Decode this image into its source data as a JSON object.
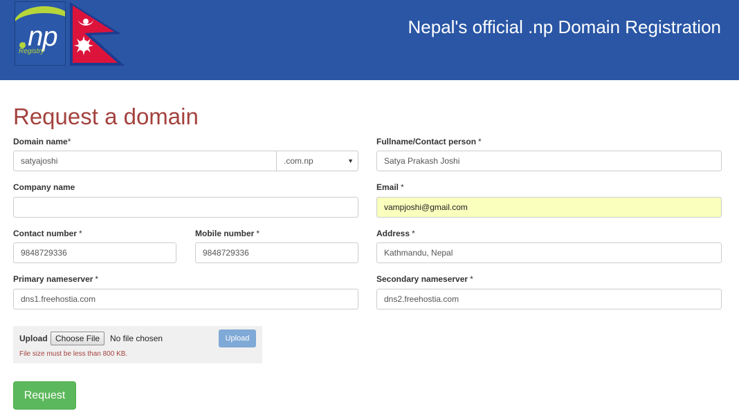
{
  "header": {
    "site_title": "Nepal's official .np Domain Registration",
    "logo_text": ".np",
    "logo_subtext": "Registry"
  },
  "page": {
    "heading": "Request a domain"
  },
  "form": {
    "domain_name": {
      "label": "Domain name",
      "required_mark": "*",
      "value": "satyajoshi"
    },
    "tld": {
      "selected": ".com.np"
    },
    "fullname": {
      "label": "Fullname/Contact person",
      "required_mark": "*",
      "value": "Satya Prakash Joshi"
    },
    "company": {
      "label": "Company name",
      "value": ""
    },
    "email": {
      "label": "Email",
      "required_mark": "*",
      "value": "vampjoshi@gmail.com"
    },
    "contact_number": {
      "label": "Contact number",
      "required_mark": "*",
      "value": "9848729336"
    },
    "mobile_number": {
      "label": "Mobile number",
      "required_mark": "*",
      "value": "9848729336"
    },
    "address": {
      "label": "Address",
      "required_mark": "*",
      "value": "Kathmandu, Nepal"
    },
    "primary_ns": {
      "label": "Primary nameserver",
      "required_mark": "*",
      "value": "dns1.freehostia.com"
    },
    "secondary_ns": {
      "label": "Secondary nameserver",
      "required_mark": "*",
      "value": "dns2.freehostia.com"
    }
  },
  "upload": {
    "label": "Upload",
    "choose_button": "Choose File",
    "status": "No file chosen",
    "upload_button": "Upload",
    "note": "File size must be less than 800 KB."
  },
  "actions": {
    "request_button": "Request"
  },
  "colors": {
    "header_bg": "#2a56a5",
    "heading": "#a3423e",
    "primary_button": "#5cb85c",
    "upload_button": "#7fa9d6",
    "autofill": "#faffbd"
  },
  "icons": {
    "select_caret": "▼"
  }
}
